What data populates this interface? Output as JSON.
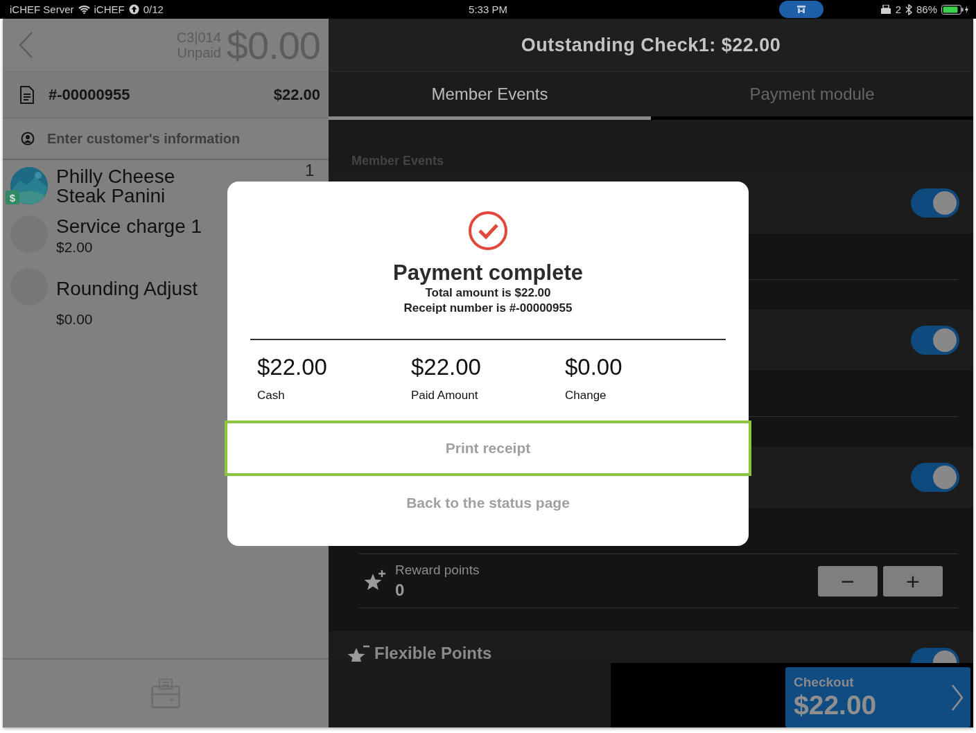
{
  "status_bar": {
    "carrier": "iCHEF Server",
    "network": "iCHEF",
    "sync": "0/12",
    "time": "5:33 PM",
    "printers": "2",
    "battery": "86%"
  },
  "order": {
    "table": "C3|014",
    "status": "Unpaid",
    "amount": "$0.00",
    "receipt_number": "#-00000955",
    "receipt_total": "$22.00",
    "customer_placeholder": "Enter customer's information",
    "items": [
      {
        "name": "Philly Cheese Steak Panini",
        "quantity": "1",
        "badge": "$"
      },
      {
        "kind": "plain",
        "name": "Service charge 1",
        "price": "$2.00"
      },
      {
        "kind": "plain",
        "name": "Rounding Adjust",
        "price": "$0.00"
      }
    ]
  },
  "check": {
    "title": "Outstanding Check1: $22.00",
    "tabs": [
      {
        "label": "Member Events",
        "selected": true
      },
      {
        "label": "Payment module",
        "selected": false
      }
    ],
    "section": "Member Events",
    "events": [
      {
        "kind": "toggle",
        "on": true
      },
      {
        "kind": "toggle",
        "on": true
      },
      {
        "kind": "toggle",
        "on": true
      },
      {
        "kind": "stepper",
        "label": "Reward points",
        "value": "0",
        "minus": "−",
        "plus": "+"
      },
      {
        "kind": "header",
        "label": "Flexible Points",
        "on": true
      }
    ],
    "checkout": {
      "label": "Checkout",
      "amount": "$22.00"
    }
  },
  "dialog": {
    "title": "Payment complete",
    "lines": [
      "Total amount is $22.00",
      "Receipt number is #-00000955"
    ],
    "summary": [
      {
        "amount": "$22.00",
        "label": "Cash"
      },
      {
        "amount": "$22.00",
        "label": "Paid Amount"
      },
      {
        "amount": "$0.00",
        "label": "Change"
      }
    ],
    "buttons": [
      {
        "label": "Print receipt",
        "highlighted": true
      },
      {
        "label": "Back to the status page",
        "highlighted": false
      }
    ]
  }
}
